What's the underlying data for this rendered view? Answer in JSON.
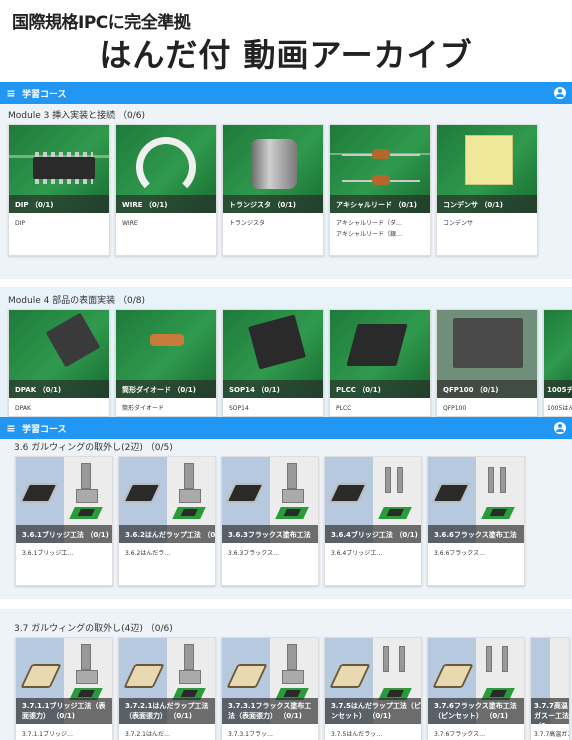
{
  "header": {
    "subtitle": "国際規格IPCに完全準拠",
    "title": "はんだ付 動画アーカイブ"
  },
  "bar1": {
    "menu_icon": "≡",
    "label": "学習コース"
  },
  "bar2": {
    "menu_icon": "≡",
    "label": "学習コース"
  },
  "module3": {
    "title": "Module 3 挿入実装と接続 （0/6)",
    "cards": [
      {
        "caption": "DIP （0/1)",
        "desc": "DIP",
        "desc2": ""
      },
      {
        "caption": "WIRE （0/1)",
        "desc": "WIRE",
        "desc2": ""
      },
      {
        "caption": "トランジスタ （0/1)",
        "desc": "トランジスタ",
        "desc2": ""
      },
      {
        "caption": "アキシャルリード （0/1)",
        "desc": "アキシャルリード（ダ…",
        "desc2": "アキシャルリード（銀…"
      },
      {
        "caption": "コンデンサ （0/1)",
        "desc": "コンデンサ",
        "desc2": ""
      }
    ]
  },
  "module4": {
    "title": "Module 4 部品の表面実装 （0/8)",
    "cards": [
      {
        "caption": "DPAK （0/1)",
        "desc": "DPAK"
      },
      {
        "caption": "筒形ダイオード （0/1)",
        "desc": "筒形ダイオード"
      },
      {
        "caption": "SOP14 （0/1)",
        "desc": "SOP14"
      },
      {
        "caption": "PLCC （0/1)",
        "desc": "PLCC"
      },
      {
        "caption": "QFP100 （0/1)",
        "desc": "QFP100"
      },
      {
        "caption": "1005チ",
        "desc": "1005はん"
      }
    ]
  },
  "section36": {
    "title": "3.6 ガルウィングの取外し(2辺) （0/5)",
    "cards": [
      {
        "caption": "3.6.1ブリッジ工法 （0/1)",
        "desc": "3.6.1ブリッジ工…"
      },
      {
        "caption": "3.6.2はんだラップ工法 （0/1)",
        "desc": "3.6.2はんだラ…"
      },
      {
        "caption": "3.6.3フラックス塗布工法 （0/1)",
        "desc": "3.6.3フラックス…"
      },
      {
        "caption": "3.6.4ブリッジ工法 （0/1)",
        "desc": "3.6.4ブリッジエ…"
      },
      {
        "caption": "3.6.6フラックス塗布工法 （0/1)",
        "desc": "3.6.6フラックス…"
      }
    ]
  },
  "section37": {
    "title": "3.7 ガルウィングの取外し(4辺) （0/6)",
    "cards": [
      {
        "caption": "3.7.1.1ブリッジ工法（表面張力） （0/1)",
        "desc": "3.7.1.1ブリッジ…"
      },
      {
        "caption": "3.7.2.1はんだラップ工法（表面張力） （0/1)",
        "desc": "3.7.2.1はんだ…"
      },
      {
        "caption": "3.7.3.1フラックス塗布工法（表面張力） （0/1)",
        "desc": "3.7.3.1フラッ…"
      },
      {
        "caption": "3.7.5はんだラップ工法（ピンセット） （0/1)",
        "desc": "3.7.5はんだラッ…"
      },
      {
        "caption": "3.7.6フラックス塗布工法（ピンセット） （0/1)",
        "desc": "3.7.6フラックス…"
      },
      {
        "caption": "3.7.7高温ガスー工法 （0",
        "desc": "3.7.7高温ガス…"
      }
    ]
  }
}
